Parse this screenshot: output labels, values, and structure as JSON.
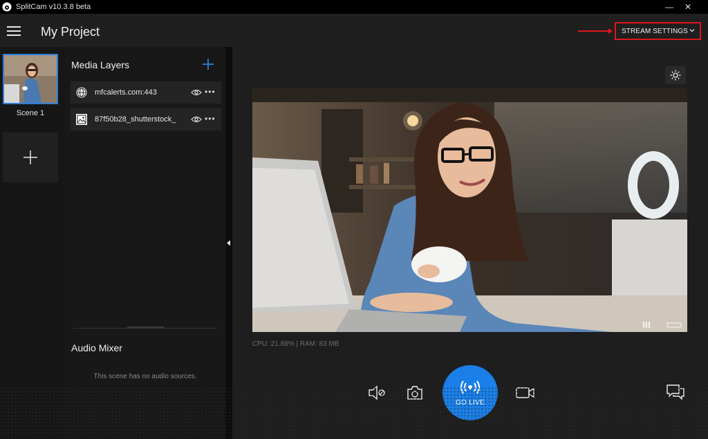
{
  "window": {
    "title": "SplitCam v10.3.8 beta",
    "minimize_symbol": "—",
    "close_symbol": "✕"
  },
  "header": {
    "project_title": "My Project",
    "stream_settings_label": "STREAM SETTINGS"
  },
  "scenes": {
    "items": [
      {
        "label": "Scene 1"
      }
    ],
    "add_symbol": "+"
  },
  "layers": {
    "heading": "Media Layers",
    "items": [
      {
        "name": "mfcalerts.com:443",
        "icon": "globe-icon",
        "more": "•••"
      },
      {
        "name": "87f50b28_shutterstock_",
        "icon": "image-icon",
        "more": "•••"
      }
    ]
  },
  "audio": {
    "heading": "Audio Mixer",
    "empty_text": "This scene has no audio sources."
  },
  "status": {
    "cpu_ram": "CPU: 21.88% | RAM: 83 MB"
  },
  "controls": {
    "go_live_label": "GO LIVE"
  },
  "colors": {
    "accent": "#1a7fe8",
    "highlight": "#e0151c",
    "background": "#1a1a1a"
  }
}
